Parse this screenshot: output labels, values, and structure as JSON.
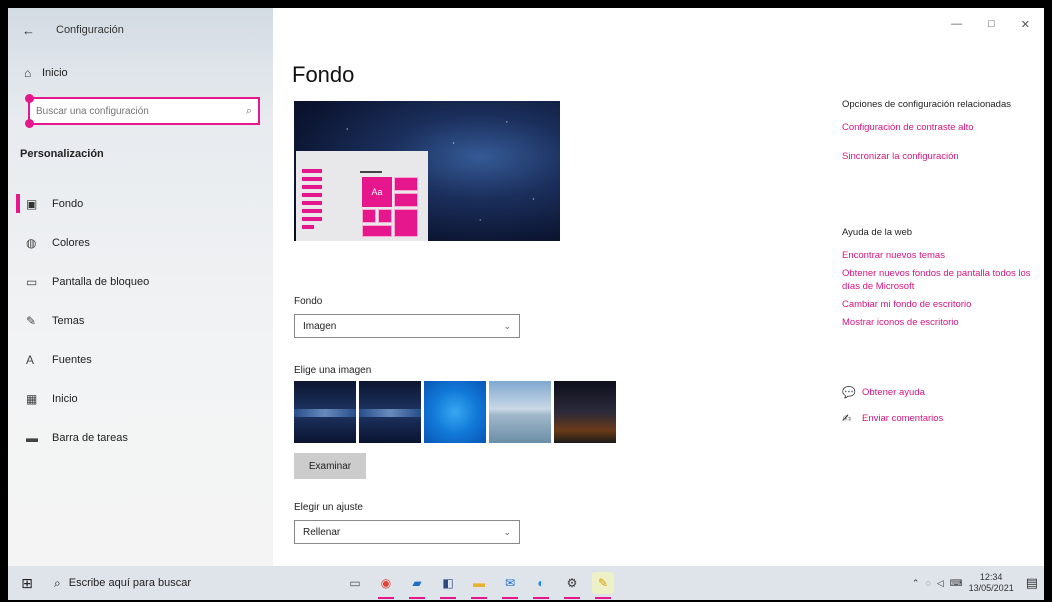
{
  "window": {
    "title": "Configuración",
    "controls": {
      "minimize": "—",
      "maximize": "□",
      "close": "✕"
    }
  },
  "sidebar": {
    "home_label": "Inicio",
    "search_placeholder": "Buscar una configuración",
    "section": "Personalización",
    "items": [
      {
        "label": "Fondo",
        "icon": "image-icon",
        "glyph": "▣",
        "active": true
      },
      {
        "label": "Colores",
        "icon": "palette-icon",
        "glyph": "◍"
      },
      {
        "label": "Pantalla de bloqueo",
        "icon": "lock-screen-icon",
        "glyph": "▭"
      },
      {
        "label": "Temas",
        "icon": "brush-icon",
        "glyph": "✎"
      },
      {
        "label": "Fuentes",
        "icon": "font-icon",
        "glyph": "A"
      },
      {
        "label": "Inicio",
        "icon": "start-icon",
        "glyph": "▦"
      },
      {
        "label": "Barra de tareas",
        "icon": "taskbar-icon",
        "glyph": "▬"
      }
    ]
  },
  "main": {
    "title": "Fondo",
    "preview_tile_text": "Aa",
    "background_label": "Fondo",
    "background_value": "Imagen",
    "choose_image_label": "Elige una imagen",
    "browse_button": "Examinar",
    "fit_label": "Elegir un ajuste",
    "fit_value": "Rellenar"
  },
  "related": {
    "heading": "Opciones de configuración relacionadas",
    "links": [
      "Configuración de contraste alto",
      "Sincronizar la configuración"
    ]
  },
  "web_help": {
    "heading": "Ayuda de la web",
    "links": [
      "Encontrar nuevos temas",
      "Obtener nuevos fondos de pantalla todos los días de Microsoft",
      "Cambiar mi fondo de escritorio",
      "Mostrar iconos de escritorio"
    ]
  },
  "help": {
    "get_help": "Obtener ayuda",
    "feedback": "Enviar comentarios"
  },
  "taskbar": {
    "search_text": "Escribe aquí para buscar",
    "time": "12:34",
    "date": "13/05/2021"
  },
  "colors": {
    "accent": "#e6168c",
    "link": "#d6157f"
  }
}
